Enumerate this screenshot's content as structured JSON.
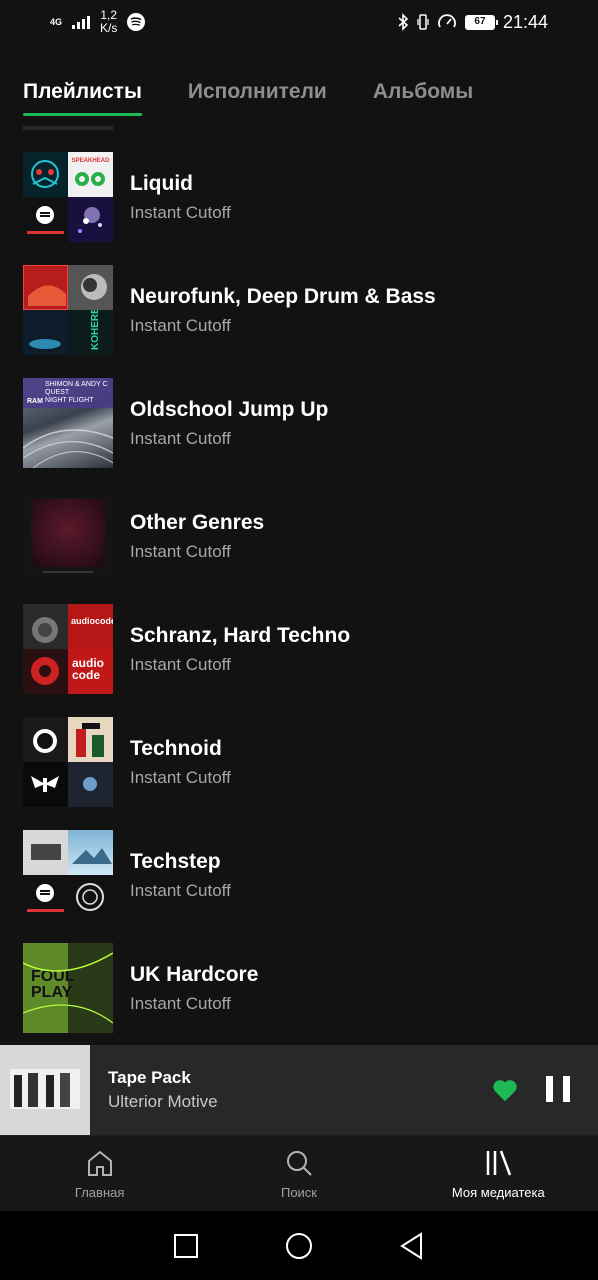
{
  "status_bar": {
    "network": "4G",
    "speed": "1,2\nK/s",
    "battery": "67",
    "time": "21:44"
  },
  "tabs": [
    {
      "label": "Плейлисты",
      "active": true
    },
    {
      "label": "Исполнители",
      "active": false
    },
    {
      "label": "Альбомы",
      "active": false
    }
  ],
  "playlists": [
    {
      "title": "Liquid",
      "owner": "Instant Cutoff"
    },
    {
      "title": "Neurofunk, Deep Drum & Bass",
      "owner": "Instant Cutoff"
    },
    {
      "title": "Oldschool Jump Up",
      "owner": "Instant Cutoff"
    },
    {
      "title": "Other Genres",
      "owner": "Instant Cutoff"
    },
    {
      "title": "Schranz, Hard Techno",
      "owner": "Instant Cutoff"
    },
    {
      "title": "Technoid",
      "owner": "Instant Cutoff"
    },
    {
      "title": "Techstep",
      "owner": "Instant Cutoff"
    },
    {
      "title": "UK Hardcore",
      "owner": "Instant Cutoff"
    }
  ],
  "cover_texts": {
    "speakhead": "SPEAKHEAD",
    "ram": "RAM",
    "shimon": "SHIMON & ANDY C\nQUEST\nNIGHT FLIGHT",
    "audiocode": "audio\ncode",
    "foulplay": "FOUL\nPLAY"
  },
  "now_playing": {
    "title": "Tape Pack",
    "artist": "Ulterior Motive",
    "liked": true
  },
  "bottom_nav": [
    {
      "label": "Главная",
      "icon": "home-icon",
      "active": false
    },
    {
      "label": "Поиск",
      "icon": "search-icon",
      "active": false
    },
    {
      "label": "Моя медиатека",
      "icon": "library-icon",
      "active": true
    }
  ],
  "colors": {
    "background": "#121212",
    "accent": "#1db954",
    "player_bg": "#282828",
    "nav_bg": "#181818"
  }
}
